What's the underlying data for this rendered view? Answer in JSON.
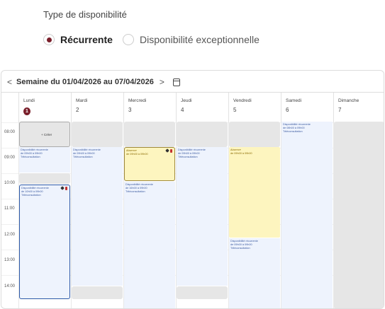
{
  "availability": {
    "title": "Type de disponibilité",
    "options": [
      {
        "label": "Récurrente",
        "selected": true
      },
      {
        "label": "Disponibilité exceptionnelle",
        "selected": false
      }
    ]
  },
  "calendar": {
    "week_label": "Semaine du 01/04/2026 au 07/04/2026",
    "prev": "<",
    "next": ">",
    "days": [
      {
        "name": "Lundi",
        "num": "1",
        "today": true
      },
      {
        "name": "Mardi",
        "num": "2"
      },
      {
        "name": "Mercredi",
        "num": "3"
      },
      {
        "name": "Jeudi",
        "num": "4"
      },
      {
        "name": "Vendredi",
        "num": "5"
      },
      {
        "name": "Samedi",
        "num": "6"
      },
      {
        "name": "Dimanche",
        "num": "7"
      }
    ],
    "hours": [
      "08:00",
      "09:00",
      "10:00",
      "11:00",
      "12:00",
      "13:00",
      "14:00"
    ],
    "create_label": "+ Créer",
    "events": {
      "mon_a": [
        "Disponibilité récurrente",
        "de 09h00 à 09h00",
        "Téléconsultation"
      ],
      "mon_b": [
        "Disponibilité récurrente",
        "de 10h00 à 09h00",
        "Téléconsultation"
      ],
      "tue": [
        "Disponibilité récurrente",
        "de 09h00 à 09h00",
        "Téléconsultation"
      ],
      "wed_abs": [
        "Absence",
        "de 09h00 à 09h00"
      ],
      "wed_b": [
        "Disponibilité récurrente",
        "de 16h00 à 09h00",
        "Téléconsultation"
      ],
      "thu": [
        "Disponibilité récurrente",
        "de 09h00 à 09h00",
        "Téléconsultation"
      ],
      "fri_abs": [
        "Absence",
        "de 09h00 à 09h00"
      ],
      "fri_b": [
        "Disponibilité récurrente",
        "de 09h00 à 09h00",
        "Téléconsultation"
      ],
      "sat": [
        "Disponibilité récurrente",
        "de 08h00 à 09h00",
        "Téléconsultation"
      ]
    }
  },
  "colors": {
    "accent": "#7a1f2b",
    "event_blue": "#eef3fd",
    "absence_yellow": "#fdf5bf"
  }
}
